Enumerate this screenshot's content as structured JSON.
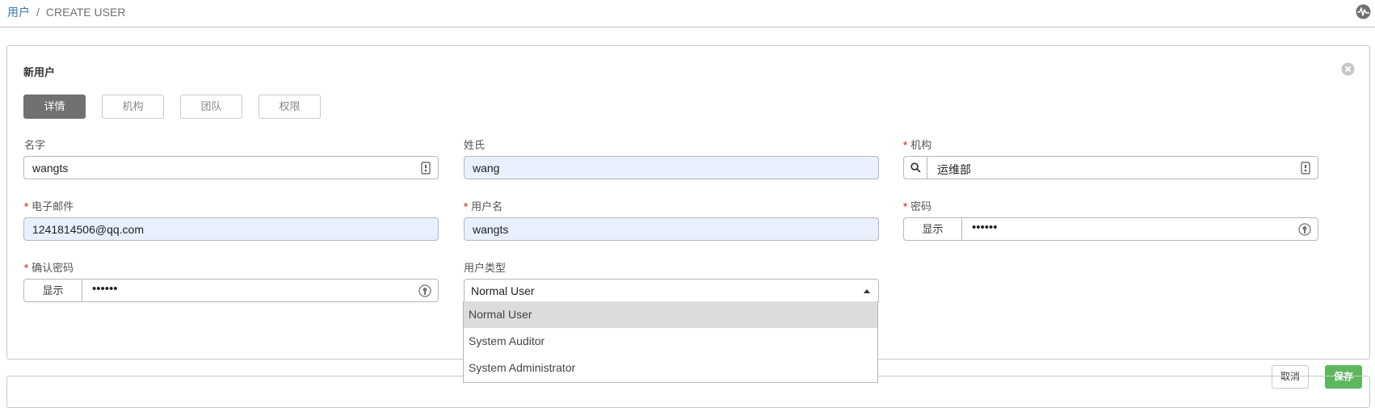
{
  "breadcrumb": {
    "link": "用户",
    "separator": "/",
    "current": "CREATE USER"
  },
  "panel": {
    "title": "新用户"
  },
  "tabs": [
    {
      "label": "详情",
      "active": true
    },
    {
      "label": "机构",
      "active": false
    },
    {
      "label": "团队",
      "active": false
    },
    {
      "label": "权限",
      "active": false
    }
  ],
  "form": {
    "first_name": {
      "label": "名字",
      "value": "wangts"
    },
    "last_name": {
      "label": "姓氏",
      "value": "wang"
    },
    "organization": {
      "label": "机构",
      "value": "运维部"
    },
    "email": {
      "label": "电子邮件",
      "value": "1241814506@qq.com"
    },
    "username": {
      "label": "用户名",
      "value": "wangts"
    },
    "password": {
      "label": "密码",
      "show_label": "显示",
      "masked": "••••••"
    },
    "confirm_password": {
      "label": "确认密码",
      "show_label": "显示",
      "masked": "••••••"
    },
    "user_type": {
      "label": "用户类型",
      "value": "Normal User",
      "options": [
        "Normal User",
        "System Auditor",
        "System Administrator"
      ]
    },
    "required_marker": "*"
  },
  "buttons": {
    "cancel": "取消",
    "save": "保存"
  },
  "colors": {
    "accent_link": "#337ab7",
    "required": "#d9534f",
    "save": "#5cb85c",
    "active_tab": "#707173",
    "autofill": "#e8f0fe"
  }
}
